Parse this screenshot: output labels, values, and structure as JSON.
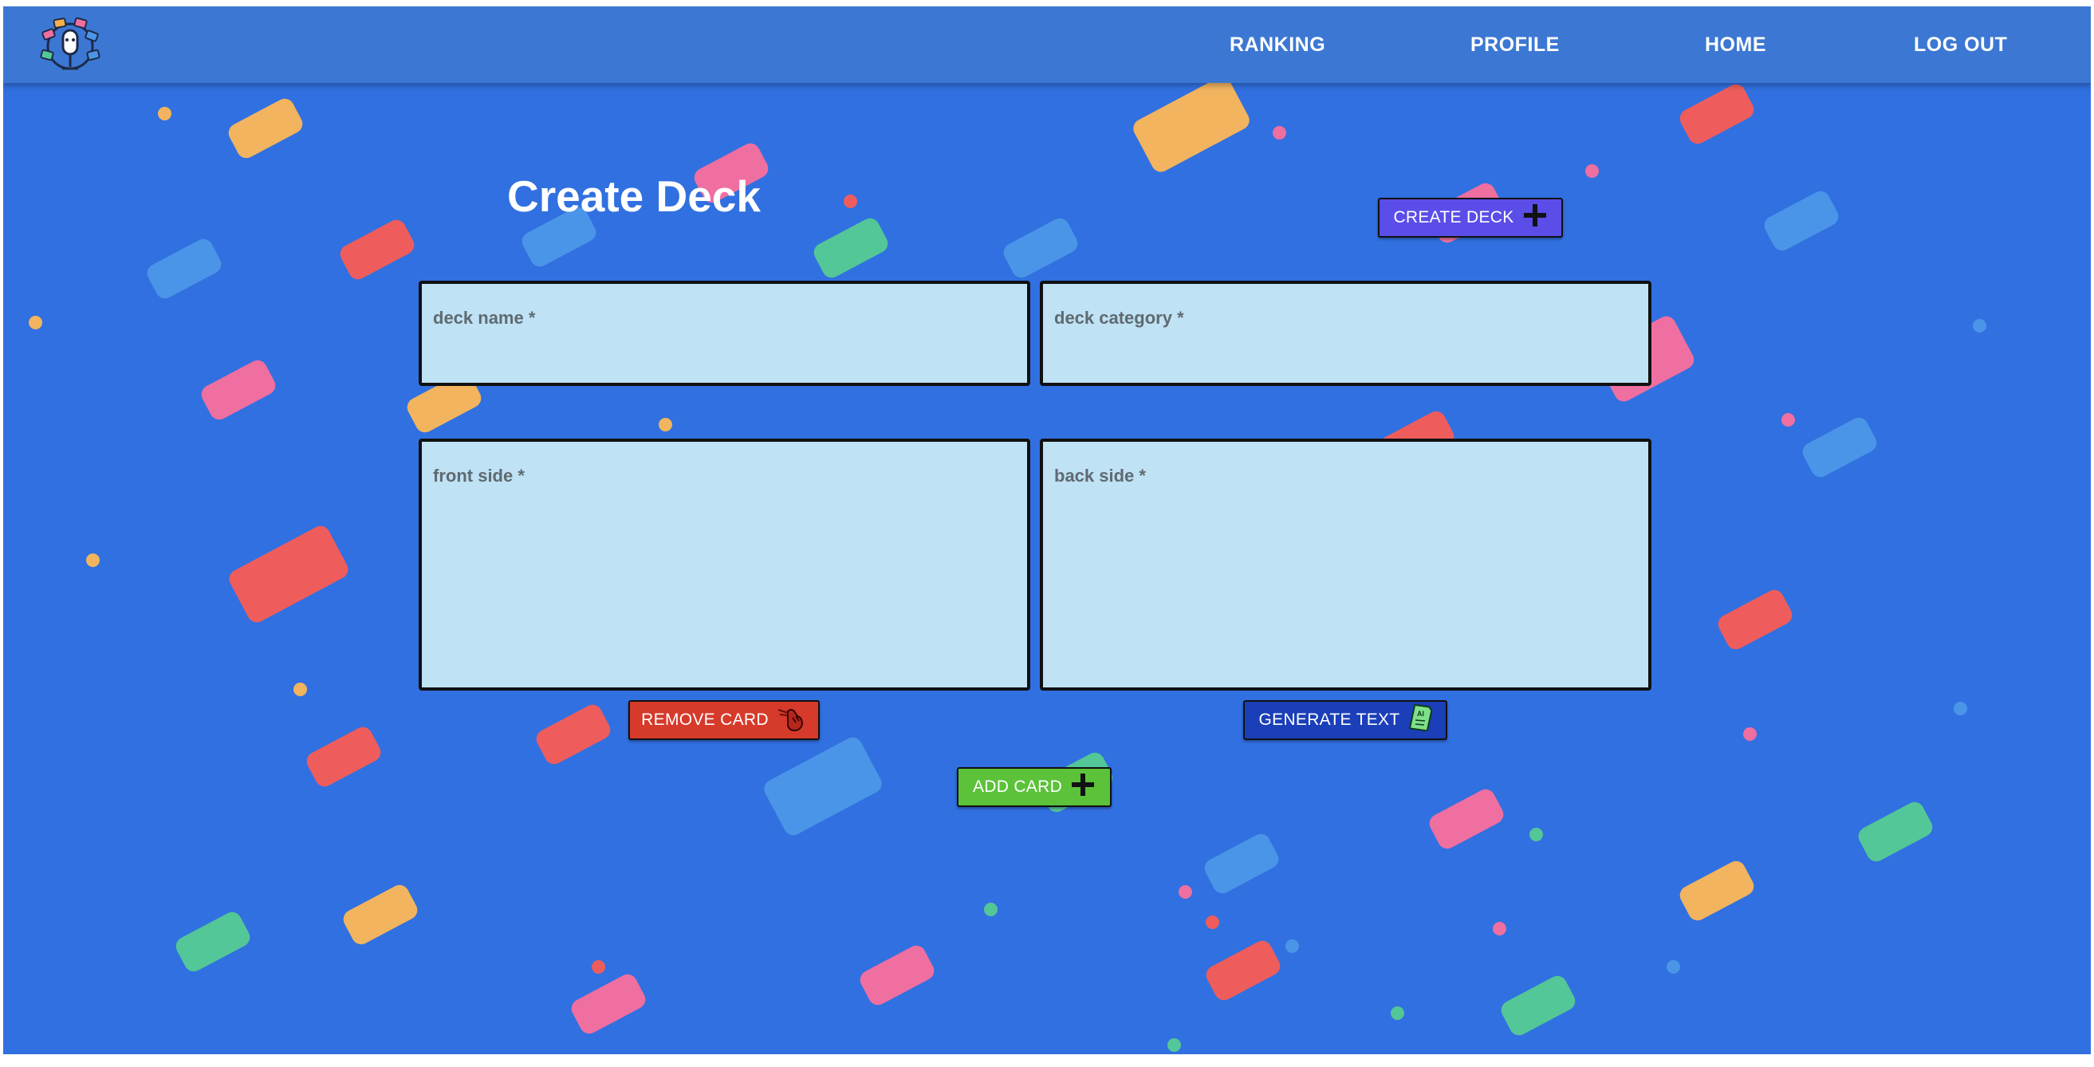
{
  "nav": {
    "logo_icon": "microphone-globe-logo-icon",
    "links": [
      "RANKING",
      "PROFILE",
      "HOME",
      "LOG OUT"
    ]
  },
  "main": {
    "title": "Create Deck",
    "create_deck_button": {
      "label": "CREATE DECK",
      "icon": "plus-icon",
      "color": "#5b4de8"
    },
    "fields": {
      "deck_name": {
        "label": "deck name *",
        "value": ""
      },
      "deck_category": {
        "label": "deck category *",
        "value": ""
      },
      "front_side": {
        "label": "front side *",
        "value": ""
      },
      "back_side": {
        "label": "back side *",
        "value": ""
      }
    },
    "remove_card_button": {
      "label": "REMOVE CARD",
      "icon": "pointing-hand-icon",
      "color": "#d63a2a"
    },
    "generate_text_button": {
      "label": "GENERATE TEXT",
      "icon": "ai-document-icon",
      "color": "#1a3fb8"
    },
    "add_card_button": {
      "label": "ADD CARD",
      "icon": "plus-icon",
      "color": "#5bc23a"
    }
  },
  "colors": {
    "background": "#3170e0",
    "navbar": "#3c78d3",
    "field_background": "#bfe2f5"
  }
}
